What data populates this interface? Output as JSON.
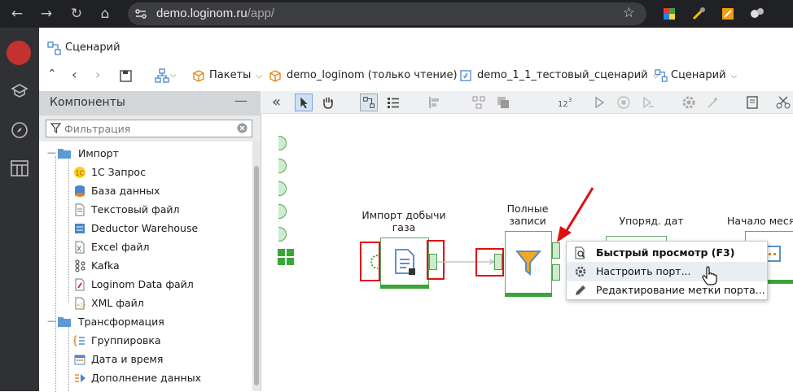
{
  "browser": {
    "url_host": "demo.loginom.ru",
    "url_path": "/app/"
  },
  "app_tab": {
    "label": "Сценарий"
  },
  "breadcrumbs": [
    {
      "label": "Пакеты"
    },
    {
      "label": "demo_loginom (только чтение)"
    },
    {
      "label": "demo_1_1_тестовый_сценарий"
    },
    {
      "label": "Сценарий"
    }
  ],
  "components_panel": {
    "title": "Компоненты",
    "filter_placeholder": "Фильтрация",
    "groups": [
      {
        "label": "Импорт",
        "items": [
          {
            "label": "1С Запрос",
            "icon": "1c-icon"
          },
          {
            "label": "База данных",
            "icon": "database-icon"
          },
          {
            "label": "Текстовый файл",
            "icon": "text-file-icon"
          },
          {
            "label": "Deductor Warehouse",
            "icon": "warehouse-icon"
          },
          {
            "label": "Excel файл",
            "icon": "excel-icon"
          },
          {
            "label": "Kafka",
            "icon": "kafka-icon"
          },
          {
            "label": "Loginom Data файл",
            "icon": "loginom-data-icon"
          },
          {
            "label": "XML файл",
            "icon": "xml-icon"
          }
        ]
      },
      {
        "label": "Трансформация",
        "items": [
          {
            "label": "Группировка",
            "icon": "grouping-icon"
          },
          {
            "label": "Дата и время",
            "icon": "calendar-icon"
          },
          {
            "label": "Дополнение данных",
            "icon": "data-fill-icon"
          }
        ]
      }
    ]
  },
  "canvas": {
    "nodes": [
      {
        "label": "Импорт добычи газа"
      },
      {
        "label_line1": "Полные",
        "label_line2": "записи"
      },
      {
        "label": "Упоряд. дат"
      },
      {
        "label": "Начало меся"
      }
    ]
  },
  "context_menu": {
    "items": [
      {
        "label": "Быстрый просмотр (F3)",
        "icon": "quick-view-icon"
      },
      {
        "label": "Настроить порт...",
        "icon": "gear-icon"
      },
      {
        "label": "Редактирование метки порта...",
        "icon": "pencil-icon"
      }
    ]
  },
  "colors": {
    "accent_green": "#3aa53a",
    "highlight_red": "#e01010",
    "rail_bg": "#2f3134"
  }
}
